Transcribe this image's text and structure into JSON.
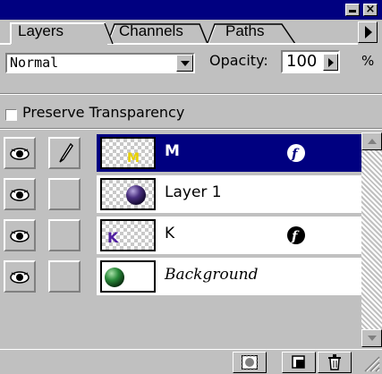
{
  "tabs": [
    {
      "label": "Layers",
      "active": true
    },
    {
      "label": "Channels",
      "active": false
    },
    {
      "label": "Paths",
      "active": false
    }
  ],
  "options": {
    "blend_mode": "Normal",
    "opacity_label": "Opacity:",
    "opacity_value": "100",
    "percent_sign": "%",
    "preserve_label": "Preserve Transparency",
    "preserve_checked": false
  },
  "layers": [
    {
      "name": "M",
      "selected": true,
      "has_effect": true,
      "thumbnail": "yellow-m-on-transparent",
      "italic": false
    },
    {
      "name": "Layer 1",
      "selected": false,
      "has_effect": false,
      "thumbnail": "purple-sphere",
      "italic": false
    },
    {
      "name": "K",
      "selected": false,
      "has_effect": true,
      "thumbnail": "purple-k-on-transparent",
      "italic": false
    },
    {
      "name": "Background",
      "selected": false,
      "has_effect": false,
      "thumbnail": "green-sphere",
      "italic": true
    }
  ],
  "colors": {
    "title_bar": "#000080",
    "selection": "#000080",
    "face": "#c0c0c0"
  }
}
